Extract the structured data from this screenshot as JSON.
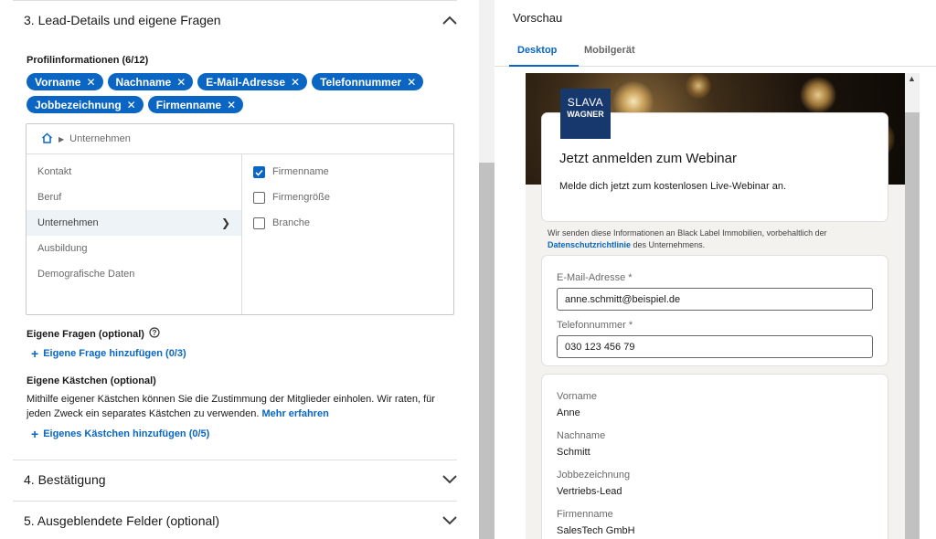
{
  "section3": {
    "title": "3.  Lead-Details und eigene Fragen"
  },
  "profile": {
    "heading": "Profilinformationen (6/12)",
    "pills_row1": [
      "Vorname",
      "Nachname",
      "E-Mail-Adresse",
      "Telefonnummer"
    ],
    "pills_row2": [
      "Jobbezeichnung",
      "Firmenname"
    ]
  },
  "picker": {
    "breadcrumb": "Unternehmen",
    "categories": [
      "Kontakt",
      "Beruf",
      "Unternehmen",
      "Ausbildung",
      "Demografische Daten"
    ],
    "active_category": "Unternehmen",
    "options": [
      {
        "label": "Firmenname",
        "checked": true
      },
      {
        "label": "Firmengröße",
        "checked": false
      },
      {
        "label": "Branche",
        "checked": false
      }
    ]
  },
  "custom_questions": {
    "heading": "Eigene Fragen (optional)",
    "add_label": "Eigene Frage hinzufügen (0/3)"
  },
  "custom_boxes": {
    "heading": "Eigene Kästchen (optional)",
    "description": "Mithilfe eigener Kästchen können Sie die Zustimmung der Mitglieder einholen. Wir raten, für jeden Zweck ein separates Kästchen zu verwenden.",
    "more_link": "Mehr erfahren",
    "add_label": "Eigenes Kästchen hinzufügen (0/5)"
  },
  "section4": {
    "title": "4.  Bestätigung"
  },
  "section5": {
    "title": "5.  Ausgeblendete Felder (optional)"
  },
  "preview": {
    "title": "Vorschau",
    "tabs": [
      "Desktop",
      "Mobilgerät"
    ],
    "active_tab": "Desktop",
    "logo_line1": "SLAVA",
    "logo_line2": "WAGNER",
    "form_title": "Jetzt anmelden zum Webinar",
    "form_subtitle": "Melde dich jetzt zum kostenlosen Live-Webinar an.",
    "privacy_text": "Wir senden diese Informationen an Black Label Immobilien, vorbehaltlich der",
    "privacy_link": "Datenschutzrichtlinie",
    "privacy_suffix": "des Unternehmens.",
    "email_label": "E-Mail-Adresse *",
    "email_value": "anne.schmitt@beispiel.de",
    "phone_label": "Telefonnummer *",
    "phone_value": "030 123 456 79",
    "fields": [
      {
        "label": "Vorname",
        "value": "Anne"
      },
      {
        "label": "Nachname",
        "value": "Schmitt"
      },
      {
        "label": "Jobbezeichnung",
        "value": "Vertriebs-Lead"
      },
      {
        "label": "Firmenname",
        "value": "SalesTech GmbH"
      }
    ]
  },
  "colors": {
    "accent": "#0a66c2",
    "logo_bg": "#17386d",
    "frame_bg": "#f3f2ef"
  },
  "icons": [
    "chevron-up-icon",
    "chevron-down-icon",
    "close-icon",
    "home-icon",
    "help-icon",
    "plus-icon",
    "check-icon",
    "chevron-right-icon",
    "scroll-up-icon"
  ]
}
